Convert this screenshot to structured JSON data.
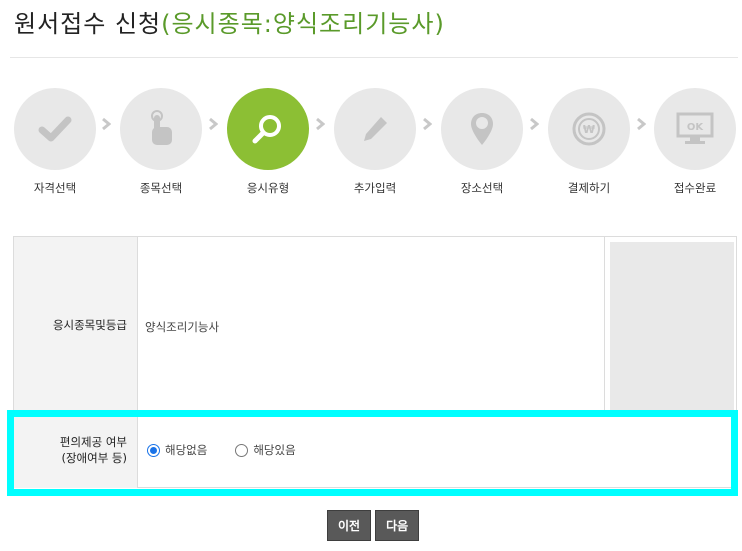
{
  "header": {
    "title": "원서접수 신청",
    "subtitle": "(응시종목:양식조리기능사)"
  },
  "steps": [
    {
      "label": "자격선택",
      "icon": "check-icon",
      "active": false
    },
    {
      "label": "종목선택",
      "icon": "hand-pointer-icon",
      "active": false
    },
    {
      "label": "응시유형",
      "icon": "search-icon",
      "active": true
    },
    {
      "label": "추가입력",
      "icon": "pencil-icon",
      "active": false
    },
    {
      "label": "장소선택",
      "icon": "map-pin-icon",
      "active": false
    },
    {
      "label": "결제하기",
      "icon": "won-coin-icon",
      "active": false
    },
    {
      "label": "접수완료",
      "icon": "ok-monitor-icon",
      "active": false
    }
  ],
  "form": {
    "row1": {
      "label": "응시종목및등급",
      "value": "양식조리기능사"
    },
    "row2": {
      "label_line1": "편의제공 여부",
      "label_line2": "(장애여부 등)",
      "options": [
        {
          "label": "해당없음",
          "checked": true
        },
        {
          "label": "해당있음",
          "checked": false
        }
      ]
    }
  },
  "buttons": {
    "prev": "이전",
    "next": "다음"
  },
  "colors": {
    "accent": "#8cbf34",
    "highlight": "#00ffff",
    "title_green": "#5a9a2a",
    "button": "#595959"
  }
}
